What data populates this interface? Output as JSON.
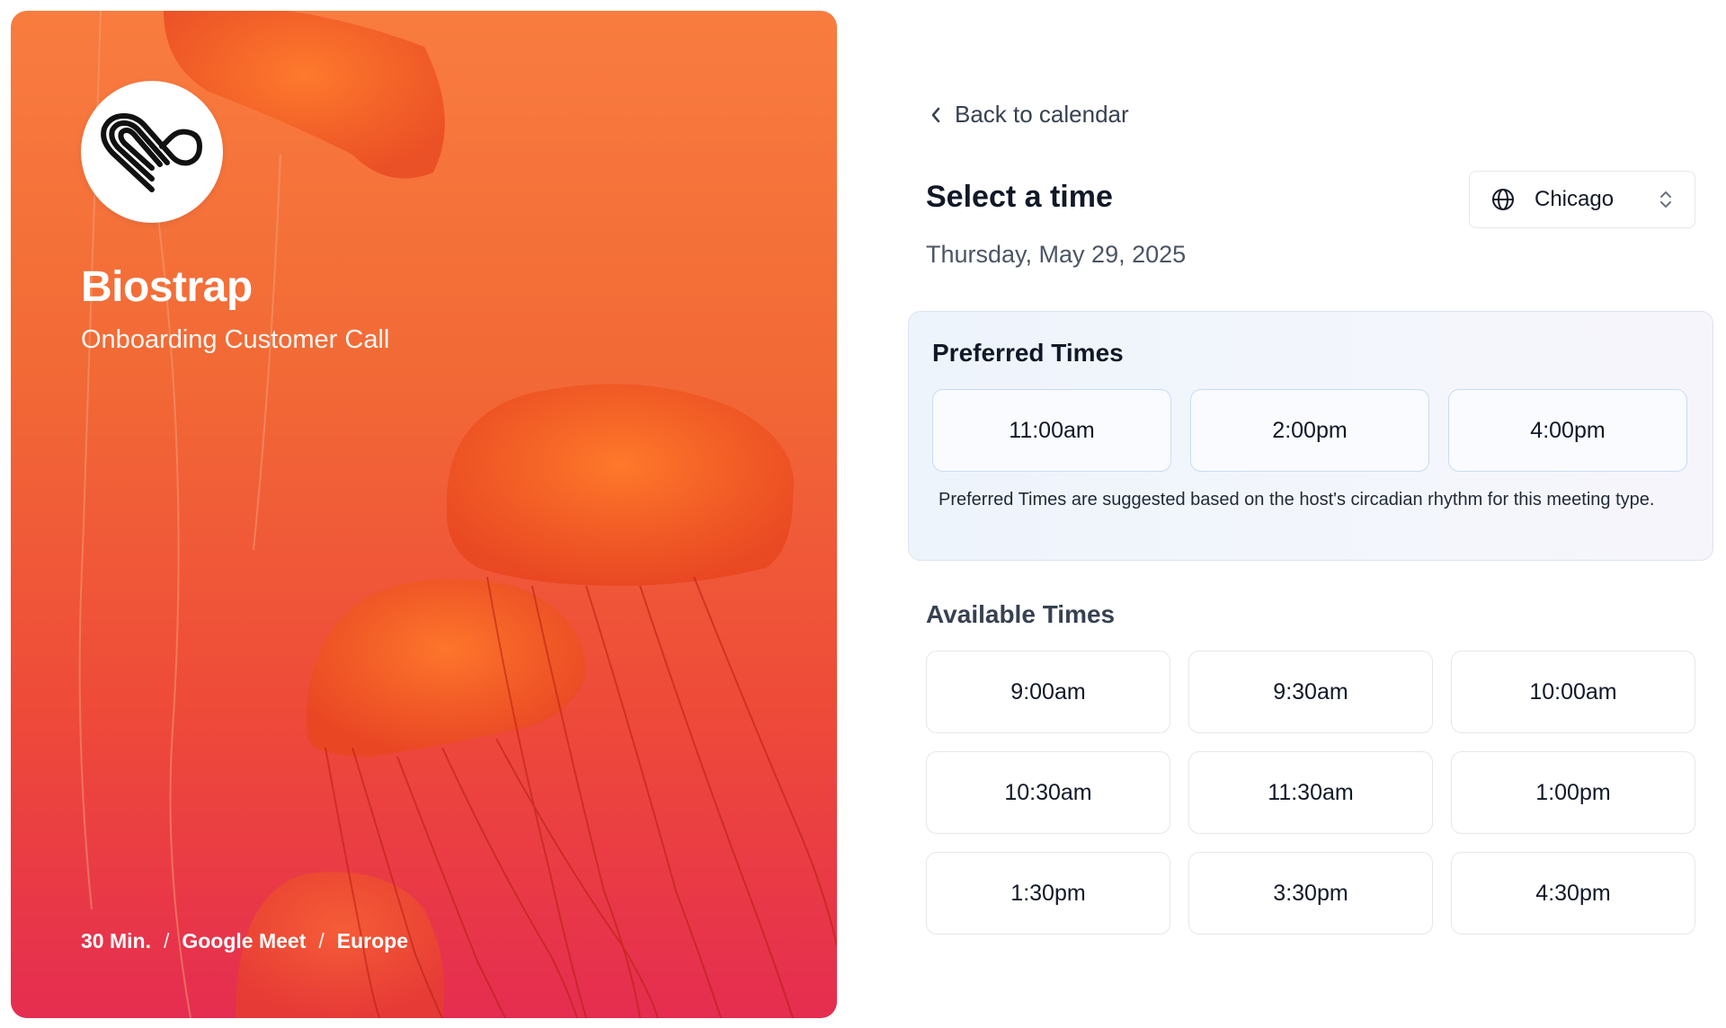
{
  "hero": {
    "brand_name": "Biostrap",
    "meeting_name": "Onboarding Customer Call",
    "logo_icon": "biostrap-heart-logo",
    "meta": {
      "duration": "30 Min.",
      "platform": "Google Meet",
      "region": "Europe",
      "separator": "/"
    },
    "colors": {
      "gradient_top": "#f97c3f",
      "gradient_bottom": "#e52d50"
    }
  },
  "panel": {
    "back_label": "Back to calendar",
    "back_icon": "chevron-left-icon",
    "title": "Select a time",
    "date": "Thursday, May 29, 2025",
    "timezone": {
      "icon": "globe-icon",
      "value": "Chicago",
      "toggle_icon": "chevron-up-down-icon"
    },
    "preferred": {
      "title": "Preferred Times",
      "slots": [
        "11:00am",
        "2:00pm",
        "4:00pm"
      ],
      "note": "Preferred Times are suggested based on the host's circadian rhythm for this meeting type."
    },
    "available": {
      "title": "Available Times",
      "slots": [
        "9:00am",
        "9:30am",
        "10:00am",
        "10:30am",
        "11:30am",
        "1:00pm",
        "1:30pm",
        "3:30pm",
        "4:30pm"
      ]
    }
  }
}
